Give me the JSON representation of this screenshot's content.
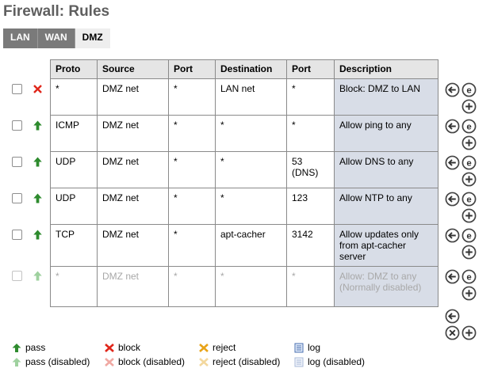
{
  "page": {
    "title": "Firewall: Rules"
  },
  "tabs": [
    {
      "label": "LAN",
      "active": false
    },
    {
      "label": "WAN",
      "active": false
    },
    {
      "label": "DMZ",
      "active": true
    }
  ],
  "table": {
    "headers": [
      "Proto",
      "Source",
      "Port",
      "Destination",
      "Port",
      "Description"
    ],
    "rows": [
      {
        "action": "block",
        "enabled": true,
        "proto": "*",
        "source": "DMZ net",
        "sport": "*",
        "dest": "LAN net",
        "dport": "*",
        "desc": "Block: DMZ to LAN"
      },
      {
        "action": "pass",
        "enabled": true,
        "proto": "ICMP",
        "source": "DMZ net",
        "sport": "*",
        "dest": "*",
        "dport": "*",
        "desc": "Allow ping to any"
      },
      {
        "action": "pass",
        "enabled": true,
        "proto": "UDP",
        "source": "DMZ net",
        "sport": "*",
        "dest": "*",
        "dport": "53\n(DNS)",
        "desc": "Allow DNS to any"
      },
      {
        "action": "pass",
        "enabled": true,
        "proto": "UDP",
        "source": "DMZ net",
        "sport": "*",
        "dest": "*",
        "dport": "123",
        "desc": "Allow NTP to any"
      },
      {
        "action": "pass",
        "enabled": true,
        "proto": "TCP",
        "source": "DMZ net",
        "sport": "*",
        "dest": "apt-cacher",
        "dport": "3142",
        "desc": "Allow updates only from apt-cacher server"
      },
      {
        "action": "pass",
        "enabled": false,
        "proto": "*",
        "source": "DMZ net",
        "sport": "*",
        "dest": "*",
        "dport": "*",
        "desc": "Allow: DMZ to any (Normally disabled)"
      }
    ]
  },
  "legend": {
    "pass": "pass",
    "pass_disabled": "pass (disabled)",
    "block": "block",
    "block_disabled": "block (disabled)",
    "reject": "reject",
    "reject_disabled": "reject (disabled)",
    "log": "log",
    "log_disabled": "log (disabled)"
  },
  "colors": {
    "pass": "#2e8b2e",
    "pass_disabled": "#9fd19f",
    "block": "#e0261a",
    "block_disabled": "#f0a9a3",
    "reject": "#e8a317",
    "reject_disabled": "#f3d89e",
    "log": "#4a6fb0",
    "tab_inactive": "#7a7a7a",
    "description_bg": "#d8dde7"
  },
  "icons": {
    "row_buttons": [
      "move-before-icon",
      "edit-icon",
      "add-icon"
    ],
    "footer_buttons": [
      "move-end-icon",
      "delete-icon",
      "add-icon"
    ]
  }
}
